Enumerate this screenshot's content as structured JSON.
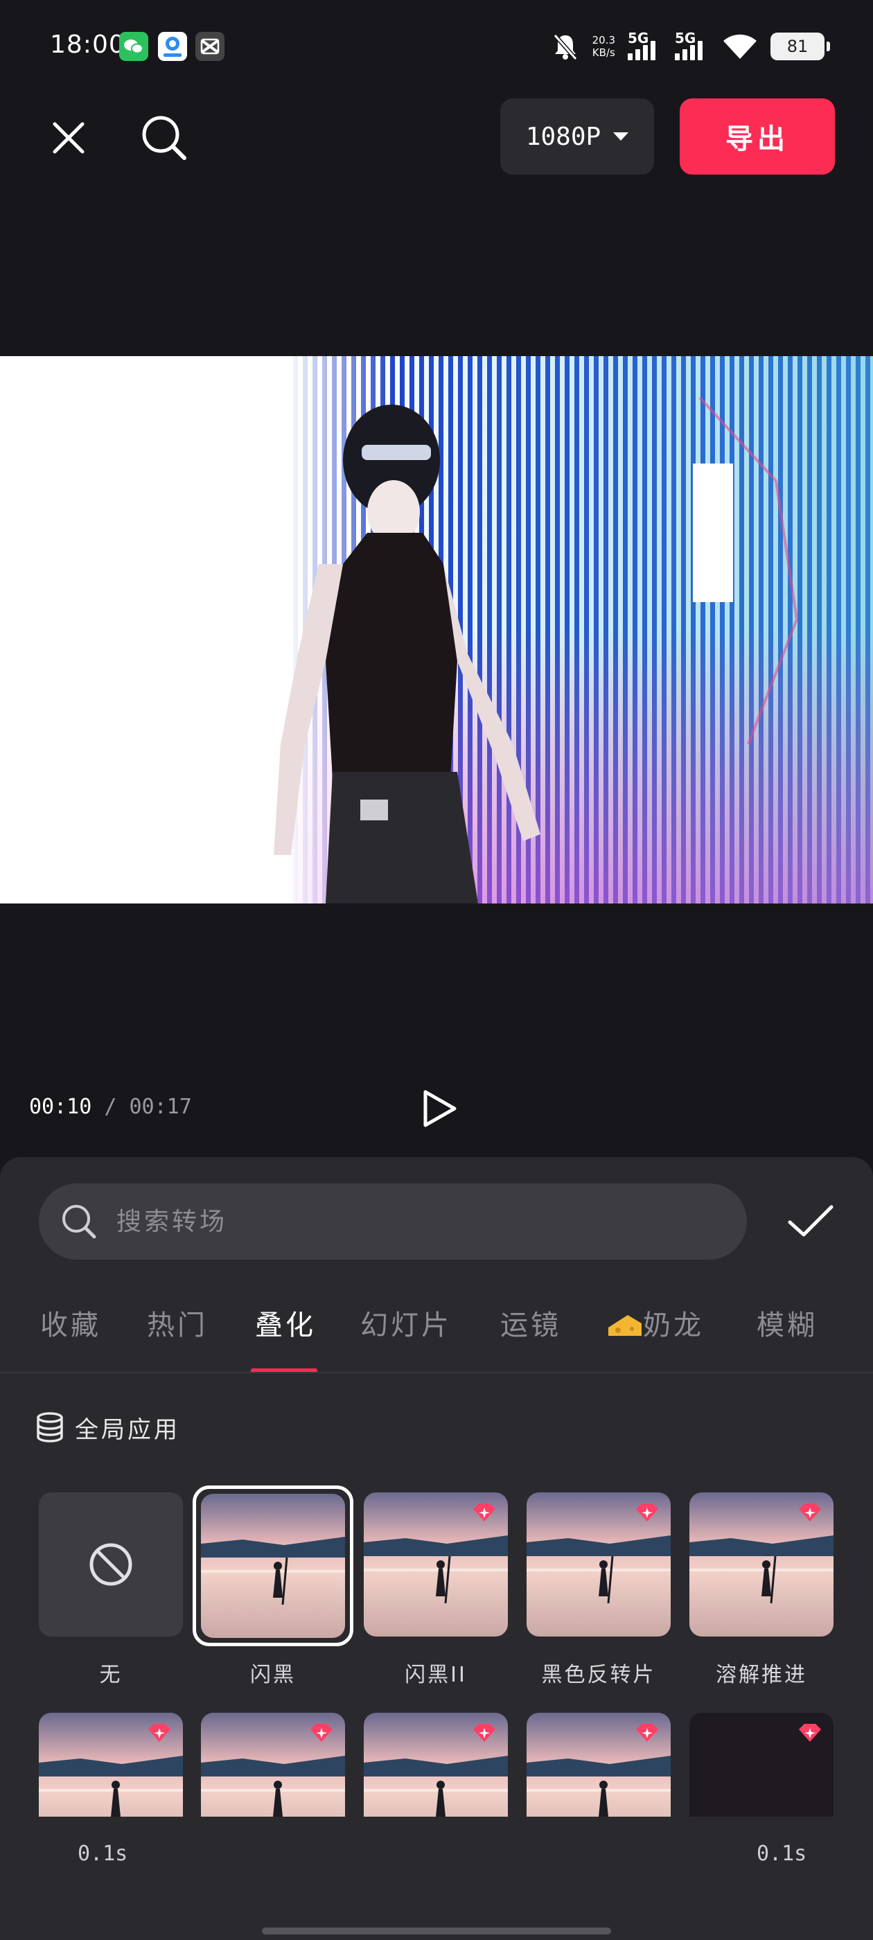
{
  "status_bar": {
    "time": "18:00",
    "net_speed_value": "20.3",
    "net_speed_unit": "KB/s",
    "signal_1_label": "5G",
    "signal_2_label": "5G",
    "battery": "81",
    "icons": [
      "wechat-icon",
      "qq-browser-icon",
      "capcut-icon",
      "mute-bell-icon",
      "wifi-icon"
    ]
  },
  "toolbar": {
    "resolution": "1080P",
    "export_label": "导出"
  },
  "player": {
    "current_time": "00:10",
    "separator": " / ",
    "total_time": "00:17"
  },
  "transition_panel": {
    "search_placeholder": "搜索转场",
    "tabs": [
      {
        "label": "收藏"
      },
      {
        "label": "热门"
      },
      {
        "label": "叠化",
        "active": true
      },
      {
        "label": "幻灯片"
      },
      {
        "label": "运镜"
      },
      {
        "label": "奶龙",
        "icon": "cheese-icon"
      },
      {
        "label": "模糊"
      }
    ],
    "global_apply_label": "全局应用",
    "items": [
      {
        "label": "无",
        "type": "none"
      },
      {
        "label": "闪黑",
        "selected": true
      },
      {
        "label": "闪黑II",
        "vip": true
      },
      {
        "label": "黑色反转片",
        "vip": true
      },
      {
        "label": "溶解推进",
        "vip": true
      }
    ],
    "row2_vip": [
      true,
      true,
      true,
      true,
      true
    ],
    "duration_left": "0.1s",
    "duration_right": "0.1s"
  },
  "colors": {
    "accent": "#fd2c55",
    "background": "#17161b",
    "panel": "#2a2a2e"
  }
}
